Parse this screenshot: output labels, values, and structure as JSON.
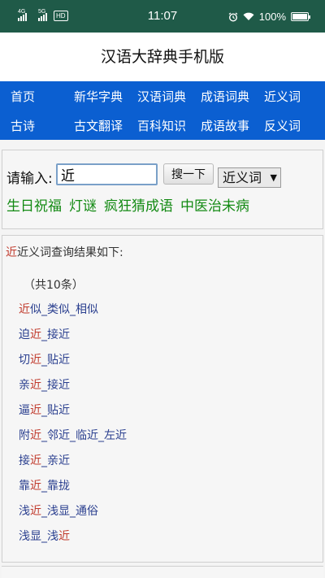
{
  "status": {
    "signal1": "4G",
    "signal2": "5G",
    "hd": "HD",
    "time": "11:07",
    "battery": "100%",
    "battery_level": 1.0
  },
  "app": {
    "title": "汉语大辞典手机版"
  },
  "nav": {
    "row1": [
      "首页",
      "新华字典",
      "汉语词典",
      "成语词典",
      "近义词"
    ],
    "row2": [
      "古诗",
      "古文翻译",
      "百科知识",
      "成语故事",
      "反义词"
    ]
  },
  "search": {
    "label": "请输入:",
    "value": "近",
    "button": "搜一下",
    "type_selected": "近义词",
    "quick_links": [
      "生日祝福",
      "灯谜",
      "疯狂猜成语",
      "中医治未病"
    ]
  },
  "results": {
    "query": "近",
    "header": "近义词查询结果如下:",
    "count": "（共10条）",
    "items": [
      [
        {
          "t": "近",
          "hl": true
        },
        {
          "t": "似_类似_相似",
          "hl": false
        }
      ],
      [
        {
          "t": "迫",
          "hl": false
        },
        {
          "t": "近",
          "hl": true
        },
        {
          "t": "_接近",
          "hl": false
        }
      ],
      [
        {
          "t": "切",
          "hl": false
        },
        {
          "t": "近",
          "hl": true
        },
        {
          "t": "_贴近",
          "hl": false
        }
      ],
      [
        {
          "t": "亲",
          "hl": false
        },
        {
          "t": "近",
          "hl": true
        },
        {
          "t": "_接近",
          "hl": false
        }
      ],
      [
        {
          "t": "逼",
          "hl": false
        },
        {
          "t": "近",
          "hl": true
        },
        {
          "t": "_贴近",
          "hl": false
        }
      ],
      [
        {
          "t": "附",
          "hl": false
        },
        {
          "t": "近",
          "hl": true
        },
        {
          "t": "_邻近_临近_左近",
          "hl": false
        }
      ],
      [
        {
          "t": "接",
          "hl": false
        },
        {
          "t": "近",
          "hl": true
        },
        {
          "t": "_亲近",
          "hl": false
        }
      ],
      [
        {
          "t": "靠",
          "hl": false
        },
        {
          "t": "近",
          "hl": true
        },
        {
          "t": "_靠拢",
          "hl": false
        }
      ],
      [
        {
          "t": "浅",
          "hl": false
        },
        {
          "t": "近",
          "hl": true
        },
        {
          "t": "_浅显_通俗",
          "hl": false
        }
      ],
      [
        {
          "t": "浅显_浅",
          "hl": false
        },
        {
          "t": "近",
          "hl": true
        }
      ]
    ]
  },
  "colors": {
    "status_bar": "#1f5a48",
    "nav_bg": "#0b5fd1",
    "highlight": "#c0392b",
    "link_green": "#138a13",
    "result_text": "#2a3f8f"
  }
}
